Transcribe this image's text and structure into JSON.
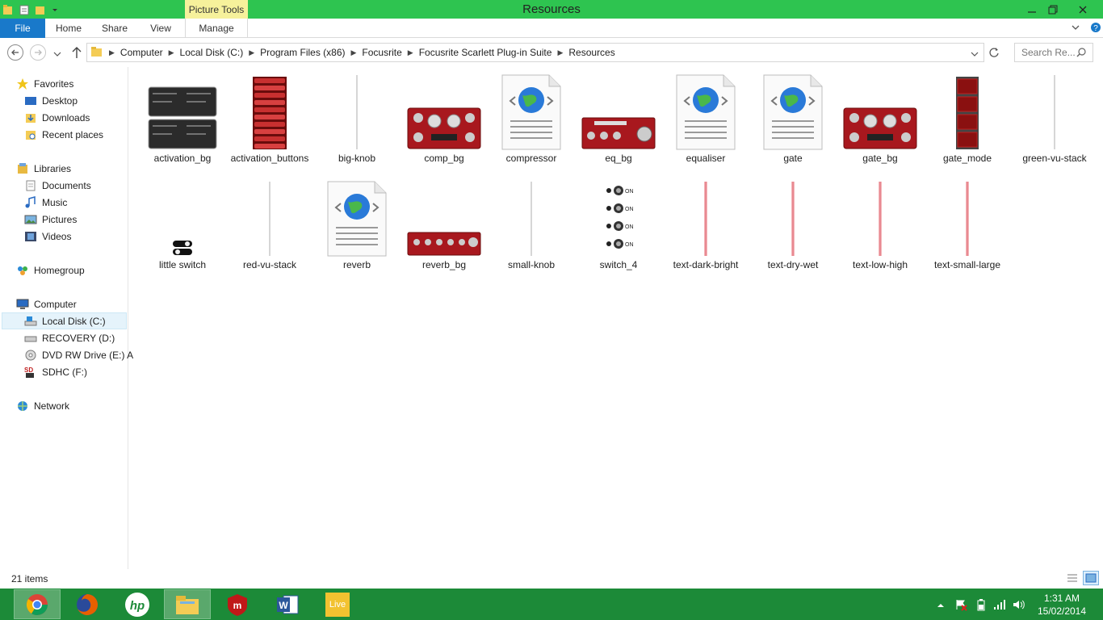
{
  "window": {
    "title": "Resources",
    "contextual_tab": "Picture Tools"
  },
  "ribbon": {
    "tabs": [
      "File",
      "Home",
      "Share",
      "View",
      "Manage"
    ]
  },
  "address": {
    "crumbs": [
      "Computer",
      "Local Disk (C:)",
      "Program Files (x86)",
      "Focusrite",
      "Focusrite Scarlett Plug-in Suite",
      "Resources"
    ]
  },
  "search": {
    "placeholder": "Search Re..."
  },
  "sidebar": {
    "favorites": {
      "label": "Favorites",
      "items": [
        "Desktop",
        "Downloads",
        "Recent places"
      ]
    },
    "libraries": {
      "label": "Libraries",
      "items": [
        "Documents",
        "Music",
        "Pictures",
        "Videos"
      ]
    },
    "homegroup": "Homegroup",
    "computer": {
      "label": "Computer",
      "items": [
        "Local Disk (C:)",
        "RECOVERY (D:)",
        "DVD RW Drive (E:) A",
        "SDHC (F:)"
      ]
    },
    "network": "Network"
  },
  "files": [
    {
      "name": "activation_bg",
      "kind": "panel-image"
    },
    {
      "name": "activation_buttons",
      "kind": "red-list-image"
    },
    {
      "name": "big-knob",
      "kind": "thin-line"
    },
    {
      "name": "comp_bg",
      "kind": "red-knob-panel"
    },
    {
      "name": "compressor",
      "kind": "html-doc"
    },
    {
      "name": "eq_bg",
      "kind": "red-eq-panel"
    },
    {
      "name": "equaliser",
      "kind": "html-doc"
    },
    {
      "name": "gate",
      "kind": "html-doc"
    },
    {
      "name": "gate_bg",
      "kind": "red-knob-panel"
    },
    {
      "name": "gate_mode",
      "kind": "red-stack"
    },
    {
      "name": "green-vu-stack",
      "kind": "thin-line"
    },
    {
      "name": "little switch",
      "kind": "switch"
    },
    {
      "name": "red-vu-stack",
      "kind": "thin-line"
    },
    {
      "name": "reverb",
      "kind": "html-doc"
    },
    {
      "name": "reverb_bg",
      "kind": "red-strip"
    },
    {
      "name": "small-knob",
      "kind": "thin-line"
    },
    {
      "name": "switch_4",
      "kind": "switch-column"
    },
    {
      "name": "text-dark-bright",
      "kind": "pink-line"
    },
    {
      "name": "text-dry-wet",
      "kind": "pink-line"
    },
    {
      "name": "text-low-high",
      "kind": "pink-line"
    },
    {
      "name": "text-small-large",
      "kind": "pink-line"
    }
  ],
  "status": {
    "count": "21 items"
  },
  "taskbar": {
    "apps": [
      "chrome-icon",
      "firefox-icon",
      "hp-icon",
      "file-explorer-icon",
      "mcafee-icon",
      "word-icon",
      "live-icon"
    ],
    "live_label": "Live",
    "time": "1:31 AM",
    "date": "15/02/2014"
  },
  "colors": {
    "titlebar": "#2ec450",
    "file_tab": "#1979ca",
    "taskbar": "#1c8a38",
    "picture_tools": "#f6f19b"
  }
}
